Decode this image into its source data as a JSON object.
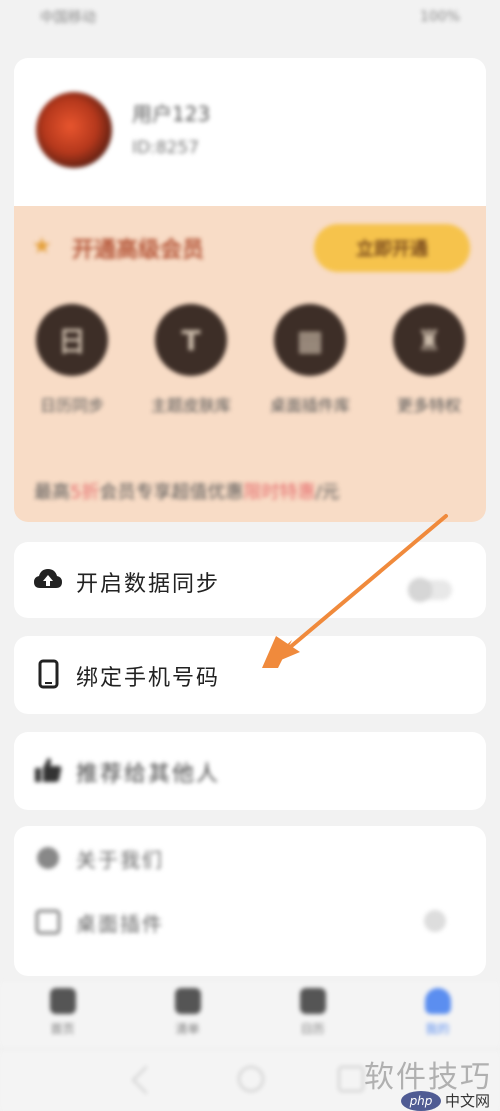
{
  "status_bar": {
    "left": "中国移动",
    "right": "100%"
  },
  "profile": {
    "username": "用户123",
    "user_id": "ID:8257"
  },
  "vip": {
    "title": "开通高级会员",
    "button": "立即开通",
    "perks": [
      {
        "icon": "calendar-icon",
        "glyph": "日",
        "label": "日历同步"
      },
      {
        "icon": "theme-icon",
        "glyph": "T",
        "label": "主题皮肤库"
      },
      {
        "icon": "widget-icon",
        "glyph": "▦",
        "label": "桌面插件库"
      },
      {
        "icon": "more-icon",
        "glyph": "♜",
        "label": "更多特权"
      }
    ],
    "footer_prefix": "最高",
    "footer_highlight": "5折",
    "footer_middle": "会员专享超值优惠",
    "footer_highlight2": "限时特惠",
    "footer_suffix": "/元"
  },
  "menu": {
    "sync": {
      "icon": "cloud-upload-icon",
      "label": "开启数据同步",
      "toggle": false
    },
    "bind_phone": {
      "icon": "phone-icon",
      "label": "绑定手机号码"
    },
    "recommend": {
      "icon": "thumbs-up-icon",
      "label": "推荐给其他人"
    },
    "about": {
      "icon": "info-icon",
      "label": "关于我们"
    },
    "widget": {
      "icon": "widget-icon",
      "label": "桌面插件"
    }
  },
  "bottom_nav": [
    {
      "icon": "home-icon",
      "label": "首页",
      "active": false
    },
    {
      "icon": "list-icon",
      "label": "清单",
      "active": false
    },
    {
      "icon": "calendar-icon",
      "label": "日历",
      "active": false
    },
    {
      "icon": "user-icon",
      "label": "我的",
      "active": true
    }
  ],
  "watermark": "软件技巧",
  "logo": {
    "badge": "php",
    "text": "中文网"
  },
  "colors": {
    "arrow": "#f08a3c",
    "accent": "#5b8ef0",
    "vip_bg": "#f8dcc6",
    "vip_button": "#f6c34c"
  }
}
